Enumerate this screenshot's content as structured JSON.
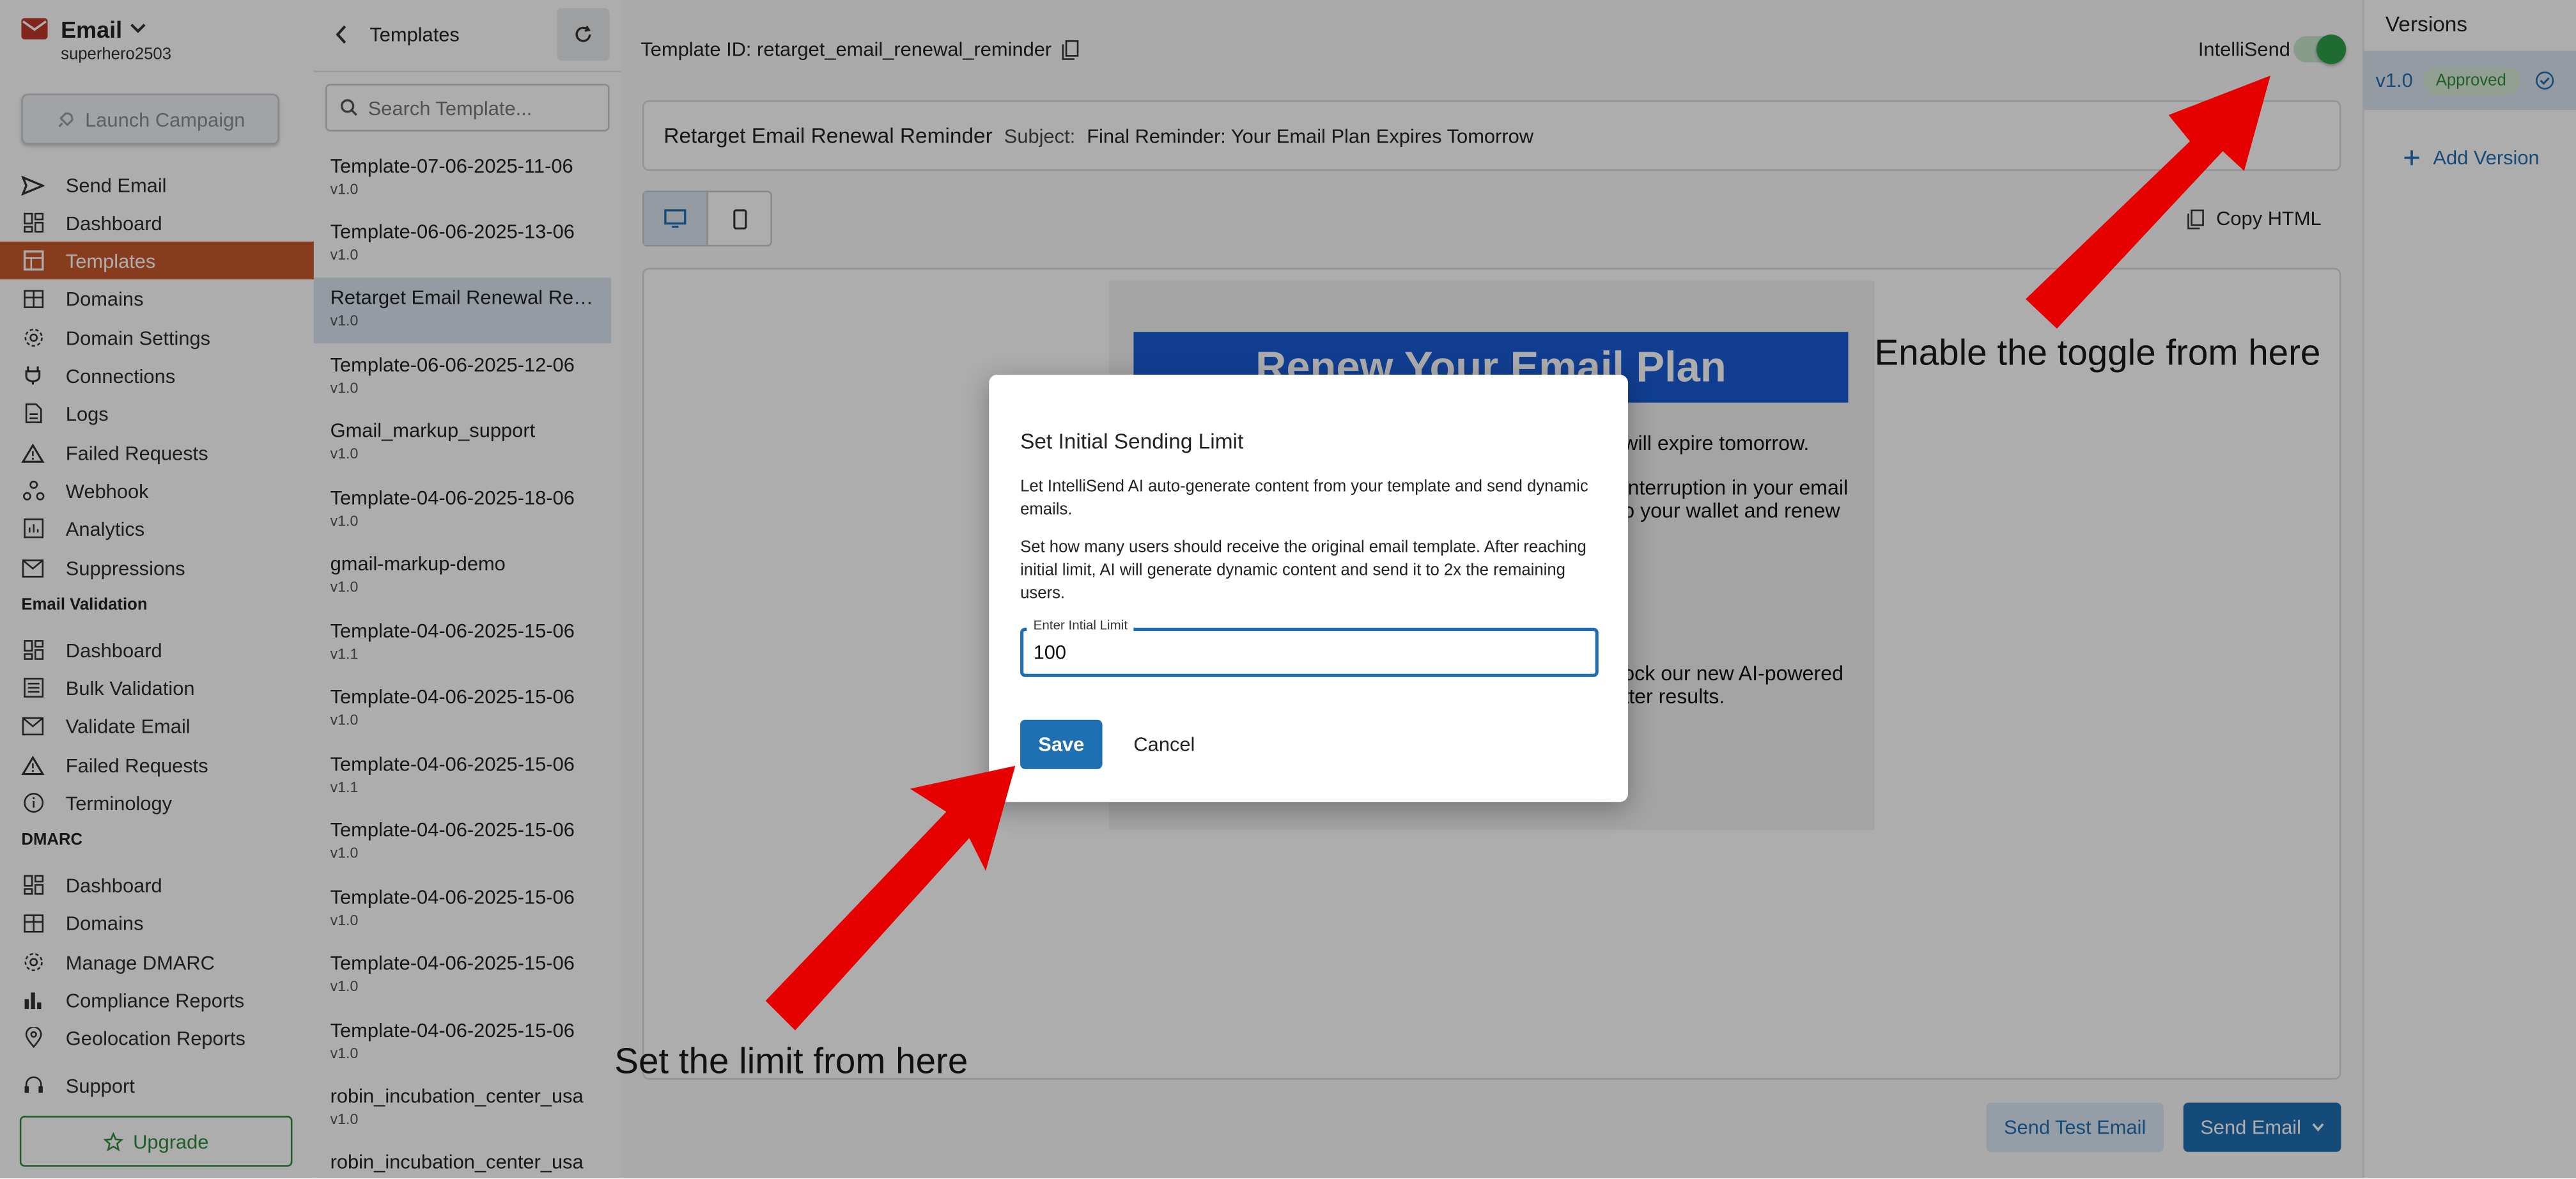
{
  "app": {
    "name": "Email",
    "user": "superhero2503",
    "launch_label": "Launch Campaign",
    "upgrade_label": "Upgrade"
  },
  "nav": {
    "items": [
      {
        "label": "Send Email",
        "icon": "send-icon"
      },
      {
        "label": "Dashboard",
        "icon": "dashboard-icon"
      },
      {
        "label": "Templates",
        "icon": "templates-icon",
        "active": true
      },
      {
        "label": "Domains",
        "icon": "domains-icon"
      },
      {
        "label": "Domain Settings",
        "icon": "gear-icon"
      },
      {
        "label": "Connections",
        "icon": "plug-icon"
      },
      {
        "label": "Logs",
        "icon": "logs-icon"
      },
      {
        "label": "Failed Requests",
        "icon": "warning-icon"
      },
      {
        "label": "Webhook",
        "icon": "webhook-icon"
      },
      {
        "label": "Analytics",
        "icon": "analytics-icon"
      },
      {
        "label": "Suppressions",
        "icon": "mail-x-icon"
      }
    ],
    "email_validation_title": "Email Validation",
    "email_validation_items": [
      {
        "label": "Dashboard",
        "icon": "dashboard-icon"
      },
      {
        "label": "Bulk Validation",
        "icon": "bulk-icon"
      },
      {
        "label": "Validate Email",
        "icon": "mail-icon"
      },
      {
        "label": "Failed Requests",
        "icon": "warning-icon"
      },
      {
        "label": "Terminology",
        "icon": "info-icon"
      }
    ],
    "dmarc_title": "DMARC",
    "dmarc_items": [
      {
        "label": "Dashboard",
        "icon": "dashboard-icon"
      },
      {
        "label": "Domains",
        "icon": "domains-icon"
      },
      {
        "label": "Manage DMARC",
        "icon": "gear-icon"
      },
      {
        "label": "Compliance Reports",
        "icon": "bar-chart-icon"
      },
      {
        "label": "Geolocation Reports",
        "icon": "location-icon"
      }
    ],
    "support_label": "Support"
  },
  "templates_panel": {
    "title": "Templates",
    "search_placeholder": "Search Template...",
    "items": [
      {
        "name": "Template-07-06-2025-11-06",
        "version": "v1.0"
      },
      {
        "name": "Template-06-06-2025-13-06",
        "version": "v1.0"
      },
      {
        "name": "Retarget Email Renewal Remin...",
        "version": "v1.0",
        "selected": true
      },
      {
        "name": "Template-06-06-2025-12-06",
        "version": "v1.0"
      },
      {
        "name": "Gmail_markup_support",
        "version": "v1.0"
      },
      {
        "name": "Template-04-06-2025-18-06",
        "version": "v1.0"
      },
      {
        "name": "gmail-markup-demo",
        "version": "v1.0"
      },
      {
        "name": "Template-04-06-2025-15-06",
        "version": "v1.1"
      },
      {
        "name": "Template-04-06-2025-15-06",
        "version": "v1.0"
      },
      {
        "name": "Template-04-06-2025-15-06",
        "version": "v1.1"
      },
      {
        "name": "Template-04-06-2025-15-06",
        "version": "v1.0"
      },
      {
        "name": "Template-04-06-2025-15-06",
        "version": "v1.0"
      },
      {
        "name": "Template-04-06-2025-15-06",
        "version": "v1.0"
      },
      {
        "name": "Template-04-06-2025-15-06",
        "version": "v1.0"
      },
      {
        "name": "robin_incubation_center_usa",
        "version": "v1.0"
      },
      {
        "name": "robin_incubation_center_usa",
        "version": ""
      }
    ]
  },
  "main": {
    "template_id_label": "Template ID: retarget_email_renewal_reminder",
    "intellisend_label": "IntelliSend",
    "intellisend_on": true,
    "template_name": "Retarget Email Renewal Reminder",
    "subject_label": "Subject:",
    "subject_value": "Final Reminder: Your Email Plan Expires Tomorrow",
    "copy_html_label": "Copy HTML",
    "preview": {
      "banner": "Renew Your Email Plan",
      "line1": "will expire tomorrow.",
      "line2a": "interruption in your email",
      "line2b": "o your wallet and renew",
      "line3a": "ock our new AI-powered",
      "line3b": "tter results."
    },
    "send_test_label": "Send Test Email",
    "send_email_label": "Send Email"
  },
  "versions": {
    "title": "Versions",
    "items": [
      {
        "version": "v1.0",
        "status": "Approved"
      }
    ],
    "add_label": "Add Version"
  },
  "modal": {
    "title": "Set Initial Sending Limit",
    "para1": "Let IntelliSend AI auto-generate content from your template and send dynamic emails.",
    "para2": "Set how many users should receive the original email template. After reaching initial limit, AI will generate dynamic content and send it to 2x the remaining users.",
    "field_label": "Enter Intial Limit",
    "field_value": "100",
    "save_label": "Save",
    "cancel_label": "Cancel"
  },
  "annotations": {
    "toggle_hint": "Enable the toggle from here",
    "limit_hint": "Set the limit from here"
  },
  "colors": {
    "accent": "#1f6fb3",
    "active_nav": "#c85a2c",
    "success": "#2e9e4a",
    "arrow": "#e60000"
  }
}
